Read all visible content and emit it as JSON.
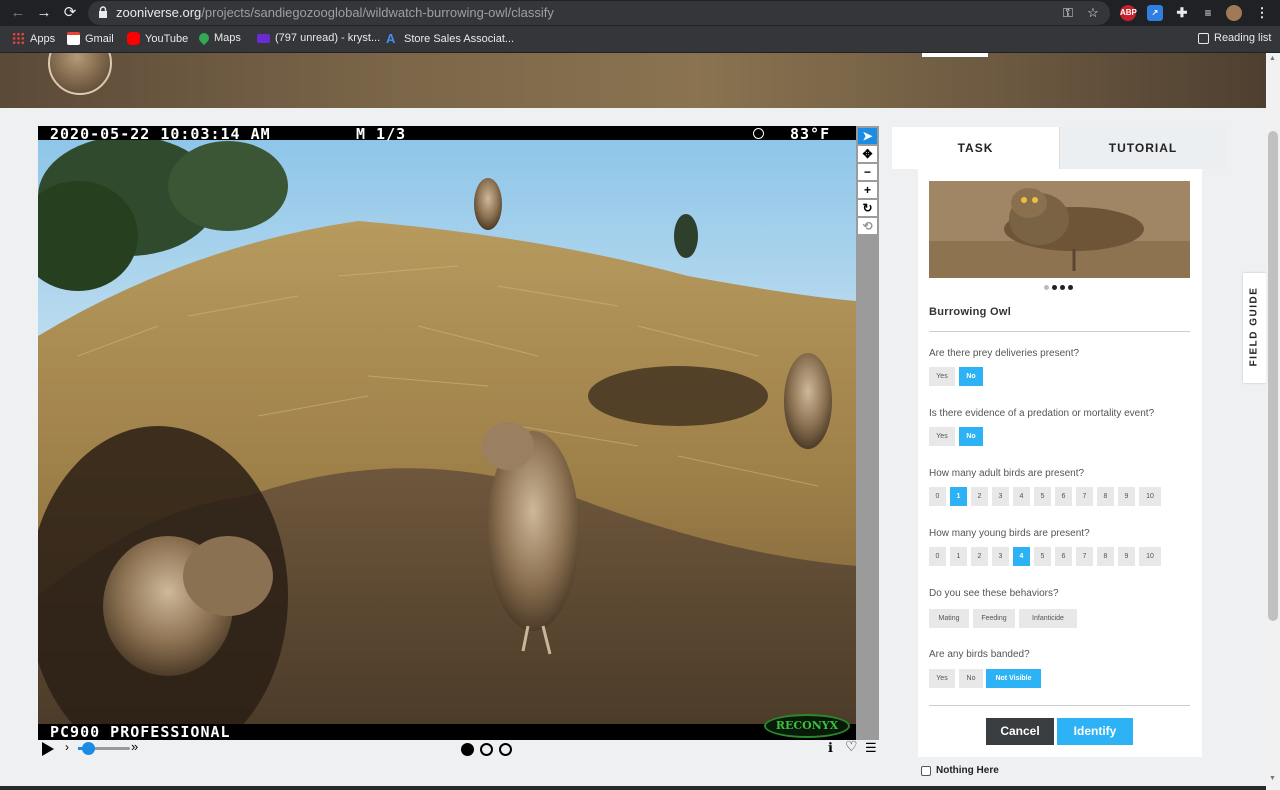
{
  "browser": {
    "url_host": "zooniverse.org",
    "url_path": "/projects/sandiegozooglobal/wildwatch-burrowing-owl/classify",
    "bookmarks": [
      {
        "label": "Apps"
      },
      {
        "label": "Gmail"
      },
      {
        "label": "YouTube"
      },
      {
        "label": "Maps"
      },
      {
        "label": "(797 unread) - kryst..."
      },
      {
        "label": "Store Sales Associat..."
      }
    ],
    "reading_list": "Reading list",
    "extension_abp": "ABP"
  },
  "camera": {
    "timestamp": "2020-05-22 10:03:14 AM",
    "frame_info": "M 1/3",
    "temperature": "83°F",
    "model": "PC900 PROFESSIONAL",
    "brand": "RECONYX"
  },
  "viewer": {
    "frames_total": 3,
    "current_frame": 1
  },
  "tabs": {
    "task": "TASK",
    "tutorial": "TUTORIAL"
  },
  "species": {
    "name": "Burrowing Owl",
    "carousel_total": 4,
    "carousel_active": 2
  },
  "questions": [
    {
      "text": "Are there prey deliveries present?",
      "options": [
        "Yes",
        "No"
      ],
      "selected": "No"
    },
    {
      "text": "Is there evidence of a predation or mortality event?",
      "options": [
        "Yes",
        "No"
      ],
      "selected": "No"
    },
    {
      "text": "How many adult birds are present?",
      "options": [
        "0",
        "1",
        "2",
        "3",
        "4",
        "5",
        "6",
        "7",
        "8",
        "9",
        "10"
      ],
      "selected": "1"
    },
    {
      "text": "How many young birds are present?",
      "options": [
        "0",
        "1",
        "2",
        "3",
        "4",
        "5",
        "6",
        "7",
        "8",
        "9",
        "10"
      ],
      "selected": "4"
    },
    {
      "text": "Do you see these behaviors?",
      "options": [
        "Mating",
        "Feeding",
        "Infanticide"
      ],
      "selected": ""
    },
    {
      "text": "Are any birds banded?",
      "options": [
        "Yes",
        "No",
        "Not Visible"
      ],
      "selected": "Not Visible"
    }
  ],
  "actions": {
    "cancel": "Cancel",
    "identify": "Identify",
    "nothing_here": "Nothing Here"
  },
  "field_guide": "FIELD GUIDE",
  "colors": {
    "accent": "#2db3f5",
    "dark_button": "#3a3d40",
    "viewer_tool_active": "#1b8ce3"
  }
}
